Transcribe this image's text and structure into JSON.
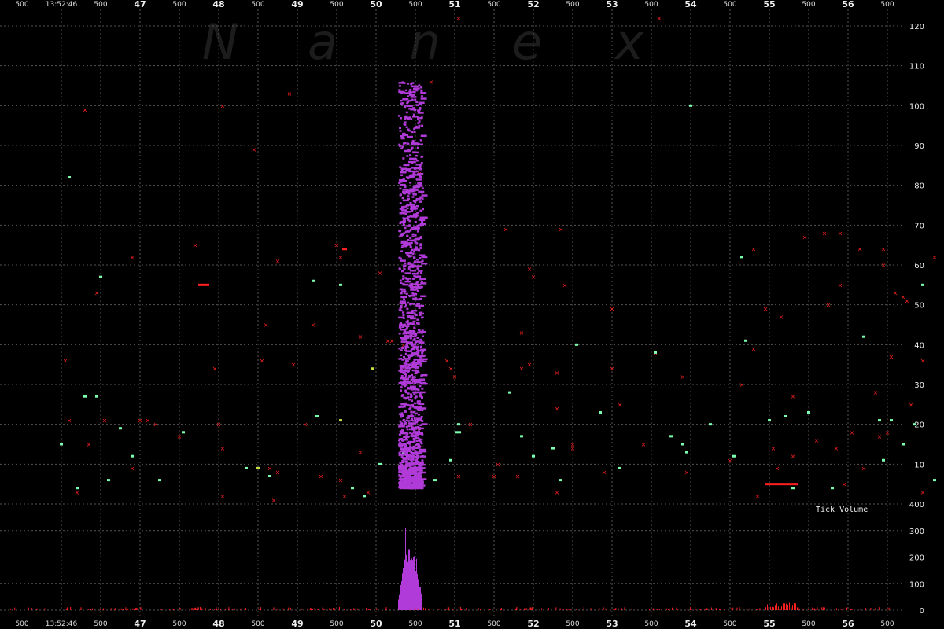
{
  "watermark": [
    "N",
    "a",
    "n",
    "e",
    "x"
  ],
  "time_start": "13:52:46",
  "x_axis": {
    "minute_labels": [
      "47",
      "48",
      "49",
      "50",
      "51",
      "52",
      "53",
      "54",
      "55",
      "56"
    ],
    "ms_label": "500"
  },
  "price_axis": {
    "ticks": [
      10,
      20,
      30,
      40,
      50,
      60,
      70,
      80,
      90,
      100,
      110,
      120
    ],
    "range": [
      4,
      122
    ]
  },
  "volume_axis": {
    "ticks": [
      0,
      100,
      200,
      300,
      400
    ],
    "label": "Tick Volume",
    "range": [
      0,
      400
    ]
  },
  "colors": {
    "background": "#000000",
    "grid": "#555555",
    "burst": "#b13bd8",
    "red": "#ff2020",
    "green": "#7dffb0",
    "yellow": "#c8e040"
  },
  "chart_data": {
    "type": "scatter",
    "title": "",
    "xlabel": "",
    "ylabel": "",
    "x_range_seconds": [
      45.8,
      57.5
    ],
    "grid": true,
    "series": [
      {
        "color": "purple",
        "burst_x_range": [
          50.28,
          50.58
        ],
        "price_range": [
          4,
          106
        ]
      },
      {
        "color": "red",
        "points": [
          [
            46.05,
            36
          ],
          [
            46.1,
            21
          ],
          [
            46.2,
            3
          ],
          [
            46.3,
            99
          ],
          [
            46.35,
            15
          ],
          [
            46.45,
            53
          ],
          [
            46.55,
            21
          ],
          [
            46.9,
            62
          ],
          [
            46.9,
            9
          ],
          [
            47.0,
            21
          ],
          [
            47.1,
            21
          ],
          [
            47.2,
            20
          ],
          [
            47.5,
            17
          ],
          [
            47.7,
            65
          ],
          [
            47.95,
            34
          ],
          [
            48.0,
            20
          ],
          [
            48.05,
            100
          ],
          [
            48.05,
            14
          ],
          [
            48.05,
            2
          ],
          [
            48.45,
            89
          ],
          [
            48.55,
            36
          ],
          [
            48.6,
            45
          ],
          [
            48.65,
            9
          ],
          [
            48.7,
            1
          ],
          [
            48.75,
            61
          ],
          [
            48.75,
            8
          ],
          [
            48.9,
            103
          ],
          [
            48.95,
            35
          ],
          [
            49.1,
            20
          ],
          [
            49.2,
            45
          ],
          [
            49.3,
            7
          ],
          [
            49.5,
            65
          ],
          [
            49.55,
            62
          ],
          [
            49.55,
            6
          ],
          [
            49.6,
            2
          ],
          [
            49.8,
            42
          ],
          [
            49.8,
            13
          ],
          [
            49.9,
            3
          ],
          [
            50.05,
            58
          ],
          [
            50.15,
            41
          ],
          [
            50.2,
            41
          ],
          [
            50.35,
            40
          ],
          [
            50.55,
            83
          ],
          [
            50.55,
            19
          ],
          [
            50.7,
            106
          ],
          [
            50.9,
            36
          ],
          [
            50.95,
            34
          ],
          [
            51.0,
            32
          ],
          [
            51.05,
            7
          ],
          [
            51.05,
            122
          ],
          [
            51.2,
            20
          ],
          [
            51.5,
            7
          ],
          [
            51.55,
            10
          ],
          [
            51.65,
            69
          ],
          [
            51.8,
            7
          ],
          [
            51.85,
            43
          ],
          [
            51.85,
            34
          ],
          [
            51.95,
            59
          ],
          [
            51.95,
            35
          ],
          [
            52.0,
            57
          ],
          [
            52.3,
            33
          ],
          [
            52.3,
            24
          ],
          [
            52.3,
            3
          ],
          [
            52.35,
            69
          ],
          [
            52.4,
            55
          ],
          [
            52.5,
            15
          ],
          [
            52.5,
            14
          ],
          [
            52.9,
            8
          ],
          [
            53.0,
            49
          ],
          [
            53.0,
            34
          ],
          [
            53.1,
            25
          ],
          [
            53.4,
            15
          ],
          [
            53.55,
            38
          ],
          [
            53.6,
            122
          ],
          [
            53.9,
            32
          ],
          [
            53.95,
            8
          ],
          [
            54.5,
            11
          ],
          [
            54.65,
            30
          ],
          [
            54.8,
            64
          ],
          [
            54.8,
            39
          ],
          [
            54.85,
            2
          ],
          [
            54.95,
            49
          ],
          [
            55.05,
            14
          ],
          [
            55.1,
            9
          ],
          [
            55.15,
            47
          ],
          [
            55.3,
            27
          ],
          [
            55.3,
            12
          ],
          [
            55.45,
            67
          ],
          [
            55.6,
            16
          ],
          [
            55.7,
            68
          ],
          [
            55.75,
            50
          ],
          [
            55.85,
            14
          ],
          [
            55.9,
            68
          ],
          [
            55.9,
            55
          ],
          [
            55.95,
            5
          ],
          [
            56.05,
            18
          ],
          [
            56.15,
            64
          ],
          [
            56.2,
            9
          ],
          [
            56.35,
            28
          ],
          [
            56.4,
            17
          ],
          [
            56.45,
            64
          ],
          [
            56.45,
            60
          ],
          [
            56.5,
            18
          ],
          [
            56.55,
            37
          ],
          [
            56.6,
            53
          ],
          [
            56.7,
            52
          ],
          [
            56.75,
            51
          ],
          [
            56.8,
            25
          ],
          [
            56.95,
            36
          ],
          [
            56.95,
            3
          ],
          [
            57.1,
            62
          ],
          [
            57.4,
            43
          ],
          [
            57.5,
            26
          ],
          [
            57.6,
            2
          ]
        ]
      },
      {
        "color": "green",
        "points": [
          [
            46.0,
            15
          ],
          [
            46.1,
            82
          ],
          [
            46.2,
            4
          ],
          [
            46.3,
            27
          ],
          [
            46.45,
            27
          ],
          [
            46.5,
            57
          ],
          [
            46.6,
            6
          ],
          [
            46.75,
            19
          ],
          [
            46.9,
            12
          ],
          [
            47.25,
            6
          ],
          [
            47.55,
            18
          ],
          [
            48.35,
            9
          ],
          [
            48.65,
            7
          ],
          [
            49.2,
            56
          ],
          [
            49.25,
            22
          ],
          [
            49.55,
            55
          ],
          [
            49.7,
            4
          ],
          [
            49.85,
            2
          ],
          [
            50.05,
            10
          ],
          [
            50.35,
            13
          ],
          [
            50.75,
            6
          ],
          [
            50.95,
            11
          ],
          [
            51.05,
            20
          ],
          [
            51.7,
            28
          ],
          [
            51.85,
            17
          ],
          [
            52.0,
            12
          ],
          [
            52.25,
            14
          ],
          [
            52.35,
            6
          ],
          [
            52.55,
            40
          ],
          [
            52.85,
            23
          ],
          [
            53.1,
            9
          ],
          [
            53.55,
            38
          ],
          [
            53.75,
            17
          ],
          [
            53.9,
            15
          ],
          [
            53.95,
            13
          ],
          [
            54.0,
            100
          ],
          [
            54.25,
            20
          ],
          [
            54.55,
            12
          ],
          [
            54.65,
            62
          ],
          [
            54.7,
            41
          ],
          [
            55.0,
            21
          ],
          [
            55.2,
            22
          ],
          [
            55.3,
            4
          ],
          [
            55.5,
            23
          ],
          [
            55.8,
            4
          ],
          [
            56.2,
            42
          ],
          [
            56.4,
            21
          ],
          [
            56.45,
            11
          ],
          [
            56.55,
            21
          ],
          [
            56.7,
            15
          ],
          [
            56.85,
            20
          ],
          [
            56.95,
            55
          ],
          [
            57.1,
            6
          ],
          [
            57.45,
            4
          ],
          [
            57.55,
            39
          ]
        ]
      },
      {
        "color": "yellow",
        "points": [
          [
            48.5,
            9
          ],
          [
            49.55,
            21
          ],
          [
            49.95,
            34
          ],
          [
            50.45,
            4
          ]
        ]
      }
    ]
  }
}
